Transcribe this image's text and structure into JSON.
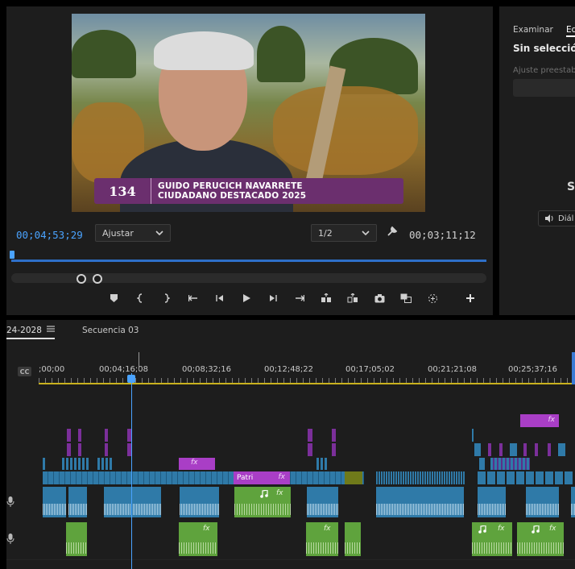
{
  "monitor": {
    "lower_third": {
      "logo": "134",
      "name": "GUIDO PERUCICH NAVARRETE",
      "subtitle": "CIUDADANO DESTACADO 2025"
    },
    "timecode_current": "00;04;53;29",
    "fit_select": "Ajustar",
    "resolution_select": "1/2",
    "timecode_duration": "00;03;11;12",
    "playback_progress": 0.0
  },
  "properties": {
    "tab_browse": "Examinar",
    "tab_edit": "Ed",
    "title": "Sin selección",
    "preset_label": "Ajuste preestablecido",
    "section_heading": "S",
    "dialog_button": "Diál"
  },
  "timeline": {
    "sequence_tab_active": "24-2028",
    "sequence_tab_menu_icon": "hamburger-menu-icon",
    "sequence_tab_other": "Secuencia 03",
    "cc_label": "CC",
    "ruler_labels": [
      ";00;00",
      "00;04;16;08",
      "00;08;32;16",
      "00;12;48;22",
      "00;17;05;02",
      "00;21;21;08",
      "00;25;37;16"
    ],
    "clip_label_patri": "Patri",
    "fx_label": "fx"
  },
  "colors": {
    "accent_blue": "#4aa3ff",
    "clip_video": "#2f7aa8",
    "clip_graphic": "#a93ec6",
    "clip_audio": "#5fa33d"
  }
}
